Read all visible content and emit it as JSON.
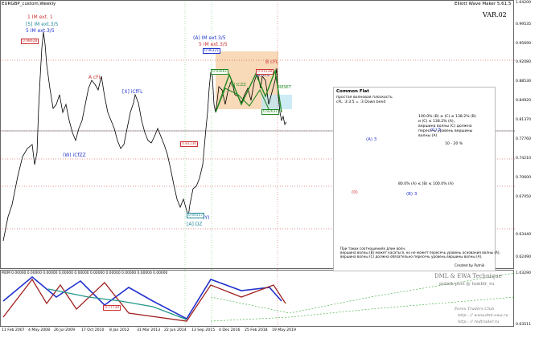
{
  "header": {
    "symbol_tf": "EURGBP_custom,Weekly",
    "indicator": "Elliott Wave Maker 5.61.5",
    "variant": "VAR.02"
  },
  "wave_labels": {
    "lines_top": [
      "1 IM ext. 1",
      "[5] IM ext.3/5",
      "5 IM ext.3/5"
    ],
    "mid_top": [
      "(A) IM ext.3/5",
      "5 IM ext.3/5"
    ],
    "a_cfl": "A cFL",
    "x_icffl": "[X] iCfFL",
    "w_icfzz": "(W) iCfZZ",
    "b_cfl": "B cFL",
    "b_icfzz": "[B] iCZZ",
    "b_cfl2": "(b) cFL",
    "a_dz": "[A] DZ",
    "y_mark": "(Y)",
    "reset": "RESET"
  },
  "price_tags": {
    "p1": "0.98628",
    "p2": "0.96321",
    "p3": "0.93061",
    "p4": "0.91538",
    "p5": "0.82631",
    "p6": "0.81130",
    "p7": "0.77730",
    "p8": "0.69357"
  },
  "info_panel": {
    "title": "Common Flat",
    "subtitle": "простая волновая плоскость",
    "formula": "cFL :3:3:5 = :3 Down bend",
    "rule_lines": [
      "100.0% (B) ≤ (C) ≤ 138.2% (B)",
      "и (C) ≤ 138.2% (A),",
      "вершина волны (C) должна",
      "пересечь уровень вершины",
      "волны (A)"
    ],
    "pct_band": "10 - 20 %",
    "b_rule": "80.0% (A) ≤ (B) ≤ 100.0% (A)",
    "wave_a": "(A) 3",
    "wave_b": "(B) 3",
    "wave_c": "(C) 5",
    "wave_0": "(0)",
    "note_lines": [
      "При таких соотношениях длин волн,",
      "вершина волны (B) может касаться, но не может пересечь уровень основания волны (A),",
      "вершина волны (C) должна обязательно пересечь уровень вершины волны (A)."
    ],
    "credit": "Created by Putnik"
  },
  "watermarks": {
    "line1": "DML & EWA Technique",
    "line2": "putnik-post @ tumblr_ru",
    "line3": "Forex    Traders    Club",
    "line4": "http : // www.dml-ewa.ru",
    "line5": "http : // redtrader.ru"
  },
  "sub_window": {
    "label": "MUM 0.00000 0.00000 0.00000 0.00000 0.00000 0.00000 0.00000 0.00000 0.00000 0.00000"
  },
  "y_axis": [
    "1.04200",
    "0.99535",
    "0.95690",
    "0.92080",
    "0.88530",
    "0.84920",
    "0.81370",
    "0.77760",
    "0.74210",
    "0.70600",
    "0.67050",
    "0.63440",
    "0.62490",
    "1.03290",
    "0.63511"
  ],
  "x_axis": [
    "11 Feb 2007",
    "4 May 2008",
    "26 Jul 2009",
    "17 Oct 2010",
    "8 Jan 2012",
    "31 Mar 2013",
    "22 Jun 2014",
    "13 Sep 2015",
    "4 Dec 2016",
    "25 Feb 2018",
    "19 May 2019"
  ],
  "colors": {
    "bull": "#000000",
    "bear_wave": "#cc2222",
    "blue_wave": "#2233cc",
    "green_wave": "#228822",
    "peach_zone": "#f8d9b8",
    "cyan_zone": "#bfe6f2"
  }
}
